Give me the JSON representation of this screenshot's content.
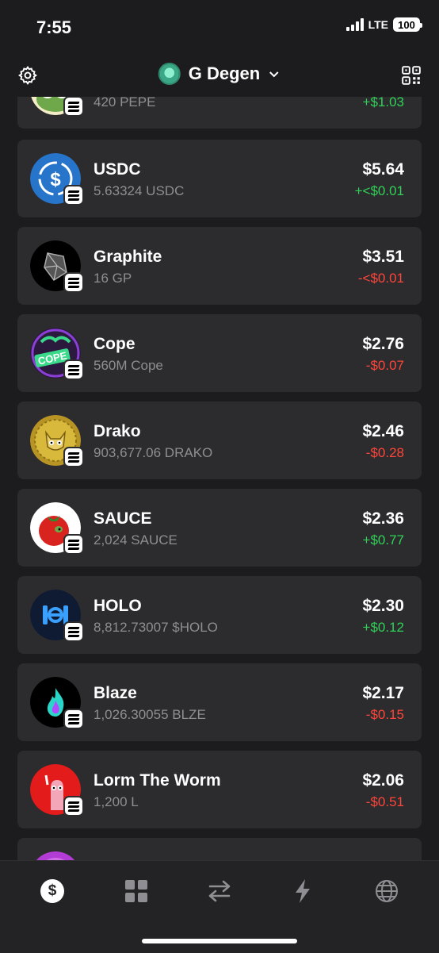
{
  "status_bar": {
    "time": "7:55",
    "network": "LTE",
    "battery": "100"
  },
  "header": {
    "account_name": "G Degen"
  },
  "tokens": [
    {
      "name": "",
      "amount": "420 PEPE",
      "value": "",
      "change": "+$1.03",
      "trend": "positive",
      "icon": "pepe-token-icon"
    },
    {
      "name": "USDC",
      "amount": "5.63324 USDC",
      "value": "$5.64",
      "change": "+<$0.01",
      "trend": "positive",
      "icon": "usdc-token-icon"
    },
    {
      "name": "Graphite",
      "amount": "16 GP",
      "value": "$3.51",
      "change": "-<$0.01",
      "trend": "negative",
      "icon": "graphite-token-icon"
    },
    {
      "name": "Cope",
      "amount": "560M Cope",
      "value": "$2.76",
      "change": "-$0.07",
      "trend": "negative",
      "icon": "cope-token-icon"
    },
    {
      "name": "Drako",
      "amount": "903,677.06 DRAKO",
      "value": "$2.46",
      "change": "-$0.28",
      "trend": "negative",
      "icon": "drako-token-icon"
    },
    {
      "name": "SAUCE",
      "amount": "2,024 SAUCE",
      "value": "$2.36",
      "change": "+$0.77",
      "trend": "positive",
      "icon": "sauce-token-icon"
    },
    {
      "name": "HOLO",
      "amount": "8,812.73007 $HOLO",
      "value": "$2.30",
      "change": "+$0.12",
      "trend": "positive",
      "icon": "holo-token-icon"
    },
    {
      "name": "Blaze",
      "amount": "1,026.30055 BLZE",
      "value": "$2.17",
      "change": "-$0.15",
      "trend": "negative",
      "icon": "blaze-token-icon"
    },
    {
      "name": "Lorm The Worm",
      "amount": "1,200 L",
      "value": "$2.06",
      "change": "-$0.51",
      "trend": "negative",
      "icon": "lorm-token-icon"
    },
    {
      "name": "",
      "amount": "",
      "value": "",
      "change": "",
      "trend": "positive",
      "icon": "partial-token-icon"
    }
  ],
  "tabs": [
    {
      "icon": "dollar-icon",
      "active": true
    },
    {
      "icon": "grid-icon",
      "active": false
    },
    {
      "icon": "swap-arrows-icon",
      "active": false
    },
    {
      "icon": "lightning-icon",
      "active": false
    },
    {
      "icon": "globe-icon",
      "active": false
    }
  ],
  "colors": {
    "background": "#1c1c1e",
    "card": "#2c2c2e",
    "positive": "#30d158",
    "negative": "#ff453a",
    "muted": "#8e8e93"
  }
}
